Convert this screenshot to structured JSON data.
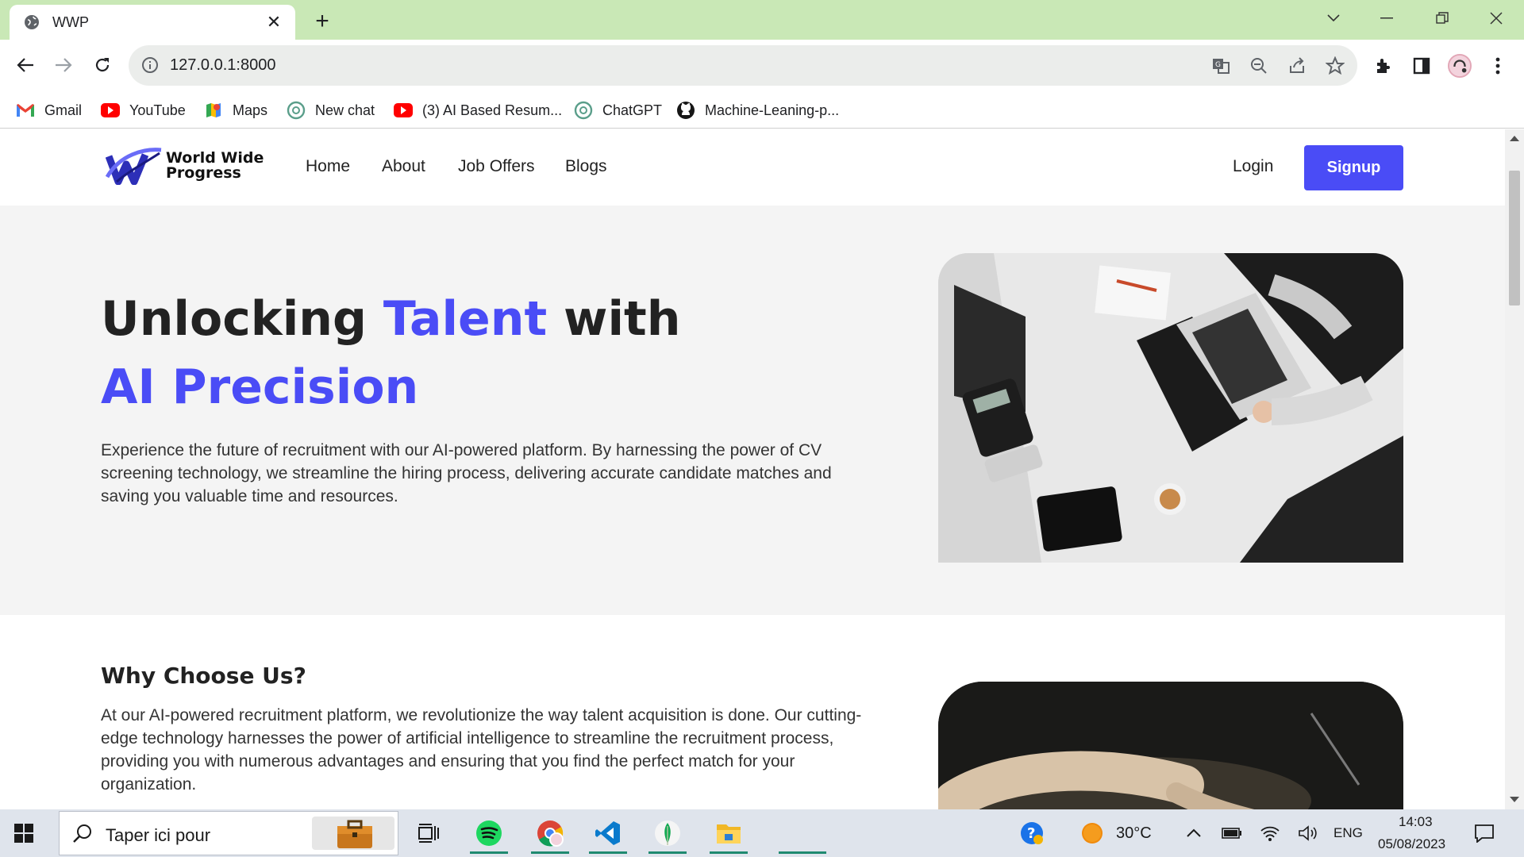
{
  "browser": {
    "tab_title": "WWP",
    "tab_close": "✕",
    "new_tab": "+",
    "url": "127.0.0.1:8000"
  },
  "bookmarks": [
    {
      "label": "Gmail",
      "icon": "gmail-icon"
    },
    {
      "label": "YouTube",
      "icon": "youtube-icon"
    },
    {
      "label": "Maps",
      "icon": "maps-icon"
    },
    {
      "label": "New chat",
      "icon": "chatgpt-icon"
    },
    {
      "label": "(3) AI Based Resum...",
      "icon": "youtube-icon"
    },
    {
      "label": "ChatGPT",
      "icon": "chatgpt-icon"
    },
    {
      "label": "Machine-Leaning-p...",
      "icon": "github-icon"
    }
  ],
  "site": {
    "brand_line1": "World Wide",
    "brand_line2": "Progress",
    "nav": [
      "Home",
      "About",
      "Job Offers",
      "Blogs"
    ],
    "login": "Login",
    "signup": "Signup",
    "hero": {
      "title_1": "Unlocking ",
      "title_2": "Talent",
      "title_3": " with ",
      "title_4": "AI Precision",
      "text": "Experience the future of recruitment with our AI-powered platform. By harnessing the power of CV screening technology, we streamline the hiring process, delivering accurate candidate matches and saving you valuable time and resources."
    },
    "why": {
      "title": "Why Choose Us?",
      "text": "At our AI-powered recruitment platform, we revolutionize the way talent acquisition is done. Our cutting-edge technology harnesses the power of artificial intelligence to streamline the recruitment process, providing you with numerous advantages and ensuring that you find the perfect match for your organization."
    }
  },
  "taskbar": {
    "search_placeholder": "Taper ici pour",
    "temperature": "30°C",
    "language": "ENG",
    "time": "14:03",
    "date": "05/08/2023"
  },
  "colors": {
    "accent": "#4a4cf6",
    "tabstrip": "#c9e8b6"
  }
}
